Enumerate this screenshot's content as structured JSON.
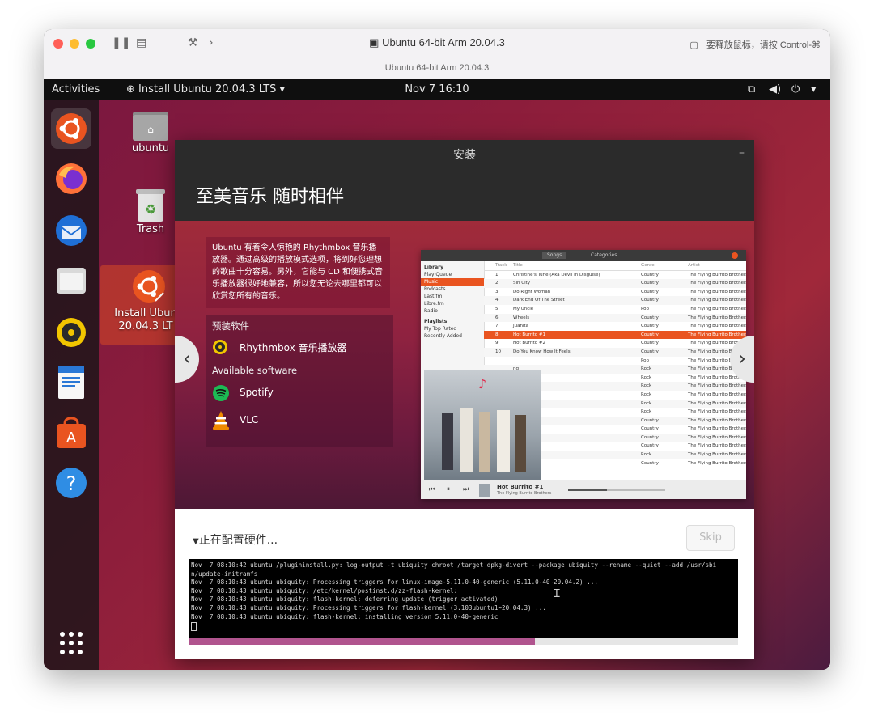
{
  "mac_window": {
    "title": "Ubuntu 64-bit Arm 20.04.3",
    "subtitle": "Ubuntu 64-bit Arm 20.04.3",
    "hint": "要释放鼠标，请按 Control-⌘"
  },
  "topbar": {
    "activities": "Activities",
    "app_menu": "Install Ubuntu 20.04.3 LTS",
    "clock": "Nov 7  16:10"
  },
  "desktop": {
    "icons": [
      {
        "label": "ubuntu"
      },
      {
        "label": "Trash"
      },
      {
        "label_line1": "Install Ubun",
        "label_line2": "20.04.3 LT"
      }
    ]
  },
  "installer": {
    "window_title": "安装",
    "slide_title": "至美音乐 随时相伴",
    "description": "Ubuntu 有着令人惊艳的 Rhythmbox 音乐播放器。通过高级的播放模式选项，将到好您理想的歌曲十分容易。另外，它能与 CD 和便携式音乐播放器很好地兼容，所以您无论去哪里都可以欣赏您所有的音乐。",
    "preinstalled_heading": "预装软件",
    "preinstalled_apps": [
      "Rhythmbox 音乐播放器"
    ],
    "available_heading": "Available software",
    "available_apps": [
      "Spotify",
      "VLC"
    ],
    "status": "正在配置硬件...",
    "skip_label": "Skip",
    "progress_fraction": 0.63,
    "terminal_lines": [
      "Nov  7 08:10:42 ubuntu /plugininstall.py: log-output -t ubiquity chroot /target dpkg-divert --package ubiquity --rename --quiet --add /usr/sbi",
      "n/update-initramfs",
      "Nov  7 08:10:43 ubuntu ubiquity: Processing triggers for linux-image-5.11.0-40-generic (5.11.0-40~20.04.2) ...",
      "Nov  7 08:10:43 ubuntu ubiquity: /etc/kernel/postinst.d/zz-flash-kernel:",
      "Nov  7 08:10:43 ubuntu ubiquity: flash-kernel: deferring update (trigger activated)",
      "Nov  7 08:10:43 ubuntu ubiquity: Processing triggers for flash-kernel (3.103ubuntu1~20.04.3) ...",
      "Nov  7 08:10:43 ubuntu ubiquity: flash-kernel: installing version 5.11.0-40-generic"
    ]
  },
  "rhythmbox": {
    "tabs": [
      "Songs",
      "Categories"
    ],
    "sidebar_heading": "Library",
    "sidebar_items": [
      "Play Queue",
      "Music",
      "Podcasts",
      "Last.fm",
      "Libre.fm",
      "Radio"
    ],
    "playlists_heading": "Playlists",
    "playlists": [
      "My Top Rated",
      "Recently Added"
    ],
    "columns": [
      "Track",
      "Title",
      "Genre",
      "Artist"
    ],
    "rows": [
      {
        "n": "1",
        "title": "Christine's Tune (Aka Devil In Disguise)",
        "genre": "Country",
        "artist": "The Flying Burrito Brothers"
      },
      {
        "n": "2",
        "title": "Sin City",
        "genre": "Country",
        "artist": "The Flying Burrito Brothers"
      },
      {
        "n": "3",
        "title": "Do Right Woman",
        "genre": "Country",
        "artist": "The Flying Burrito Brothers"
      },
      {
        "n": "4",
        "title": "Dark End Of The Street",
        "genre": "Country",
        "artist": "The Flying Burrito Brothers"
      },
      {
        "n": "5",
        "title": "My Uncle",
        "genre": "Pop",
        "artist": "The Flying Burrito Brothers"
      },
      {
        "n": "6",
        "title": "Wheels",
        "genre": "Country",
        "artist": "The Flying Burrito Brothers"
      },
      {
        "n": "7",
        "title": "Juanita",
        "genre": "Country",
        "artist": "The Flying Burrito Brothers"
      },
      {
        "n": "8",
        "title": "Hot Burrito #1",
        "genre": "Country",
        "artist": "The Flying Burrito Brothers"
      },
      {
        "n": "9",
        "title": "Hot Burrito #2",
        "genre": "Country",
        "artist": "The Flying Burrito Brothers"
      },
      {
        "n": "10",
        "title": "Do You Know How It Feels",
        "genre": "Country",
        "artist": "The Flying Burrito Brothers"
      },
      {
        "n": "",
        "title": "",
        "genre": "Pop",
        "artist": "The Flying Burrito Brot..."
      },
      {
        "n": "",
        "title": "ng",
        "genre": "Rock",
        "artist": "The Flying Burrito Brothers"
      },
      {
        "n": "",
        "title": "",
        "genre": "Rock",
        "artist": "The Flying Burrito Brothers"
      },
      {
        "n": "",
        "title": "",
        "genre": "Rock",
        "artist": "The Flying Burrito Brothers"
      },
      {
        "n": "",
        "title": "n Queen",
        "genre": "Rock",
        "artist": "The Flying Burrito Brothers"
      },
      {
        "n": "",
        "title": "",
        "genre": "Rock",
        "artist": "The Flying Burrito Brothers"
      },
      {
        "n": "",
        "title": "ng",
        "genre": "Rock",
        "artist": "The Flying Burrito Brothers"
      },
      {
        "n": "",
        "title": "",
        "genre": "Country",
        "artist": "The Flying Burrito Brothers"
      },
      {
        "n": "",
        "title": "",
        "genre": "Country",
        "artist": "The Flying Burrito Brothers"
      },
      {
        "n": "",
        "title": "",
        "genre": "Country",
        "artist": "The Flying Burrito Brothers"
      },
      {
        "n": "",
        "title": "inger",
        "genre": "Country",
        "artist": "The Flying Burrito Brothers"
      },
      {
        "n": "",
        "title": "Chumphent",
        "genre": "Rock",
        "artist": "The Flying Burrito Brothers"
      },
      {
        "n": "",
        "title": "",
        "genre": "Country",
        "artist": "The Flying Burrito Brothers"
      }
    ],
    "selected_row": 7,
    "now_playing": "Hot Burrito #1",
    "now_playing_artist": "The Flying Burrito Brothers"
  },
  "colors": {
    "ubuntu_orange": "#e95420",
    "progress": "#b0548e",
    "selected_row": "#e95420"
  }
}
